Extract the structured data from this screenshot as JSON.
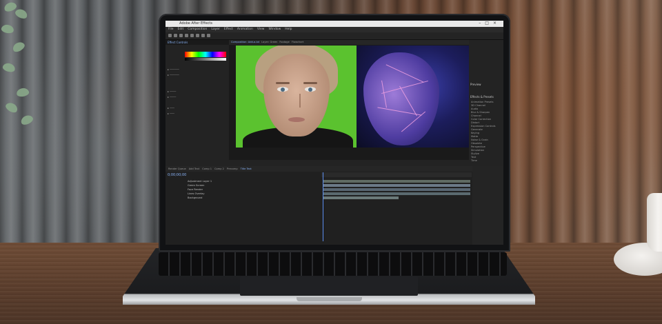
{
  "scene": {
    "description_colors": {
      "green_screen": "#5bc22f",
      "accent": "#8ab4f8",
      "table": "#5d3f2d"
    }
  },
  "app": {
    "title": "Adobe After Effects",
    "menu": [
      "File",
      "Edit",
      "Composition",
      "Layer",
      "Effect",
      "Animation",
      "View",
      "Window",
      "Help"
    ]
  },
  "effects_panel": {
    "header": "Effect Controls"
  },
  "viewer": {
    "tabs": [
      "Composition: Add-a-lot",
      "Layer: Green",
      "Footage",
      "Flowchart"
    ]
  },
  "timeline": {
    "tabs": [
      "Render Queue",
      "Add Text",
      "Comp 1",
      "Comp 2",
      "Precomp",
      "Title Text"
    ],
    "timecode": "0;00;00;00",
    "layers": [
      "Adjustment Layer 1",
      "Green Screen",
      "Face Render",
      "Lines Overlay",
      "Background"
    ]
  },
  "right_panel": {
    "preview_label": "Preview",
    "effects_label": "Effects & Presets",
    "items": [
      "Animation Presets",
      "3D Channel",
      "Audio",
      "Blur & Sharpen",
      "Channel",
      "Color Correction",
      "Distort",
      "Expression Controls",
      "Generate",
      "Keying",
      "Matte",
      "Noise & Grain",
      "Obsolete",
      "Perspective",
      "Simulation",
      "Stylize",
      "Text",
      "Time",
      "Transition",
      "Utility"
    ]
  }
}
